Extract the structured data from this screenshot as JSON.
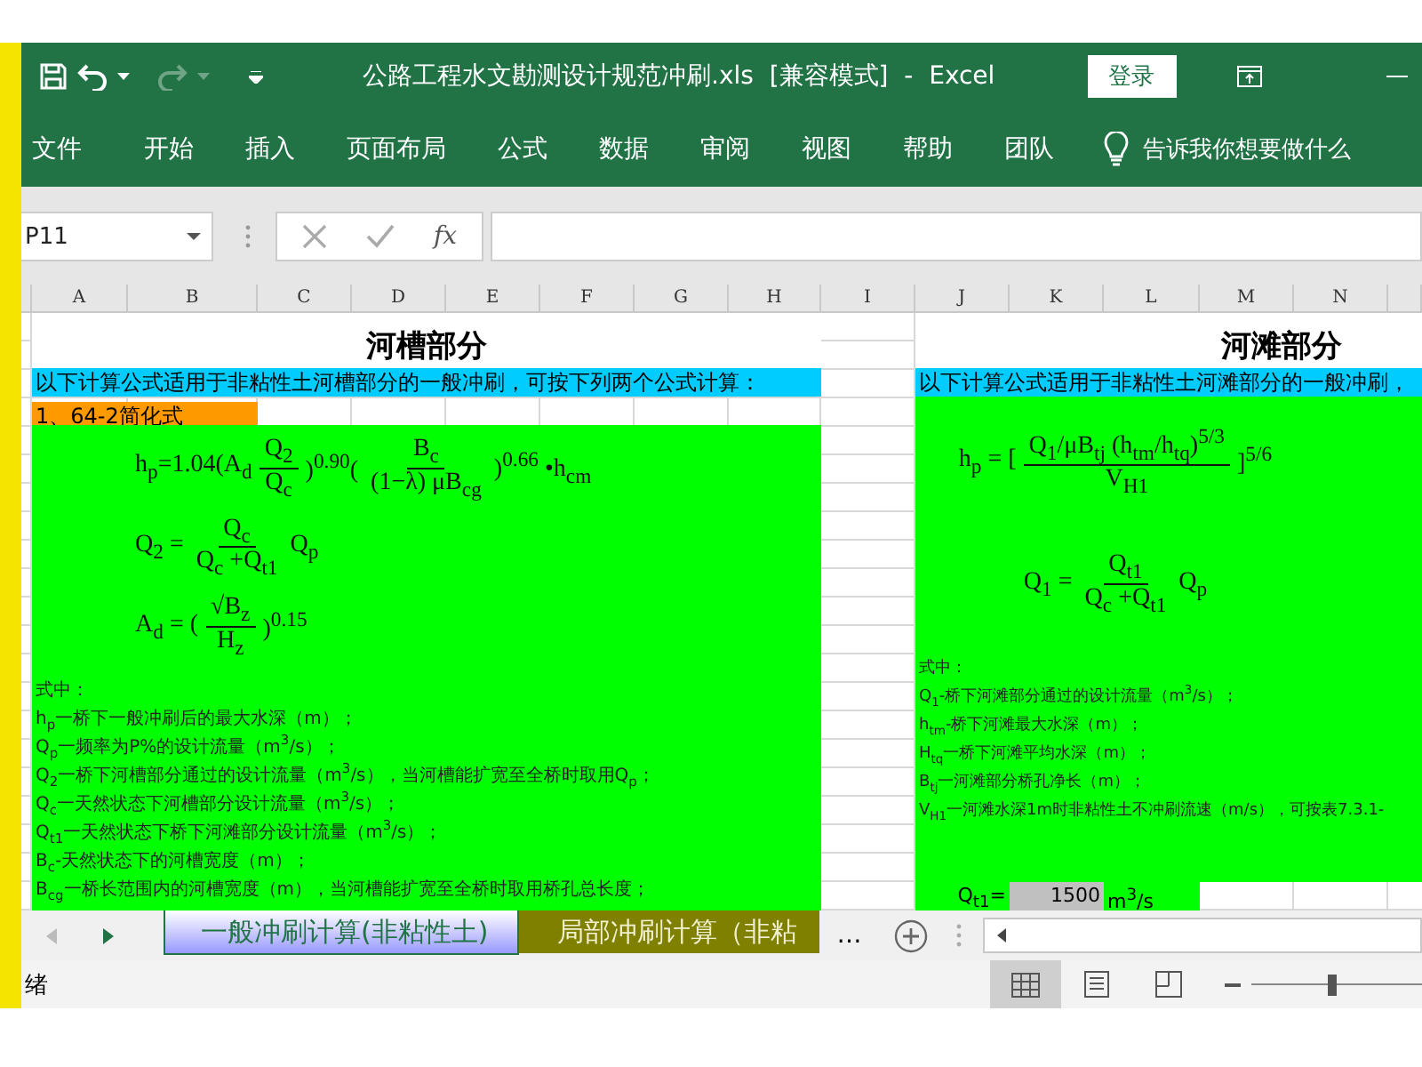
{
  "title_bar": {
    "title": "公路工程水文勘测设计规范冲刷.xls  [兼容模式]  -  Excel",
    "login": "登录"
  },
  "ribbon_tabs": [
    "文件",
    "开始",
    "插入",
    "页面布局",
    "公式",
    "数据",
    "审阅",
    "视图",
    "帮助",
    "团队"
  ],
  "tell_me": "告诉我你想要做什么",
  "formula_bar": {
    "name_box": "P11",
    "function_label": "fx"
  },
  "columns": [
    "A",
    "B",
    "C",
    "D",
    "E",
    "F",
    "G",
    "H",
    "I",
    "J",
    "K",
    "L",
    "M",
    "N"
  ],
  "river_channel": {
    "title": "河槽部分",
    "intro": "以下计算公式适用于非粘性土河槽部分的一般冲刷，可按下列两个公式计算：",
    "method": "1、64-2简化式",
    "formulas": [
      [
        {
          "kind": "text",
          "text": "h$_{p}$=1.04(A$_{d}$"
        },
        {
          "kind": "frac",
          "num": "Q$_{2}$",
          "den": "Q$_{c}$"
        },
        {
          "kind": "text",
          "text": ")$^{0.90}$("
        },
        {
          "kind": "frac",
          "num": "B$_{c}$",
          "den": "(1−λ) μB$_{cg}$"
        },
        {
          "kind": "text",
          "text": ")$^{0.66}$ •h$_{cm}$"
        }
      ],
      [
        {
          "kind": "text",
          "text": "Q$_{2}$ ="
        },
        {
          "kind": "frac",
          "num": "Q$_{c}$",
          "den": "Q$_{c}$ +Q$_{t1}$"
        },
        {
          "kind": "text",
          "text": "Q$_{p}$"
        }
      ],
      [
        {
          "kind": "text",
          "text": "A$_{d}$ = ("
        },
        {
          "kind": "frac",
          "num": "√B$_{z}$",
          "den": "H$_{z}$"
        },
        {
          "kind": "text",
          "text": ")$^{0.15}$"
        }
      ]
    ],
    "notes": [
      "式中：",
      "h$_{p}$一桥下一般冲刷后的最大水深（m）；",
      "Q$_{p}$一频率为P%的设计流量（m$^{3}$/s）；",
      "Q$_{2}$一桥下河槽部分通过的设计流量（m$^{3}$/s），当河槽能扩宽至全桥时取用Q$_{p}$；",
      "Q$_{c}$一天然状态下河槽部分设计流量（m$^{3}$/s）；",
      "Q$_{t1}$一天然状态下桥下河滩部分设计流量（m$^{3}$/s）；",
      "B$_{c}$-天然状态下的河槽宽度（m）；",
      "B$_{cg}$一桥长范围内的河槽宽度（m），当河槽能扩宽至全桥时取用桥孔总长度；"
    ]
  },
  "floodplain": {
    "title": "河滩部分",
    "intro": "以下计算公式适用于非粘性土河滩部分的一般冲刷，",
    "formulas": [
      [
        {
          "kind": "text",
          "text": "h$_{p}$ = ["
        },
        {
          "kind": "frac",
          "num": "Q$_{1}$/μB$_{tj}$ (h$_{tm}$/h$_{tq}$)$^{5/3}$",
          "den": "V$_{H1}$"
        },
        {
          "kind": "text",
          "text": "]$^{5/6}$"
        }
      ],
      [
        {
          "kind": "text",
          "text": "Q$_{1}$ ="
        },
        {
          "kind": "frac",
          "num": "Q$_{t1}$",
          "den": "Q$_{c}$ +Q$_{t1}$"
        },
        {
          "kind": "text",
          "text": "Q$_{p}$"
        }
      ]
    ],
    "notes": [
      "式中：",
      "Q$_{1}$-桥下河滩部分通过的设计流量（m$^{3}$/s）；",
      "h$_{tm}$-桥下河滩最大水深（m）；",
      "H$_{tq}$一桥下河滩平均水深（m）；",
      "B$_{tj}$一河滩部分桥孔净长（m）；",
      "V$_{H1}$一河滩水深1m时非粘性土不冲刷流速（m/s），可按表7.3.1-"
    ],
    "input": {
      "label": "Q$_{t1}$=",
      "value": "1500",
      "unit": "m$^{3}$/s"
    }
  },
  "sheet_tabs": [
    {
      "label": "一般冲刷计算(非粘性土)",
      "selected": true,
      "color": "#9999ff"
    },
    {
      "label": "局部冲刷计算（非粘",
      "selected": false,
      "color": "#808000"
    }
  ],
  "more_tabs": "…",
  "status": "绪",
  "views": [
    {
      "kind": "normal",
      "selected": true
    },
    {
      "kind": "page-layout",
      "selected": false
    },
    {
      "kind": "page-break",
      "selected": false
    }
  ],
  "zoom": {
    "level": 0.45
  }
}
